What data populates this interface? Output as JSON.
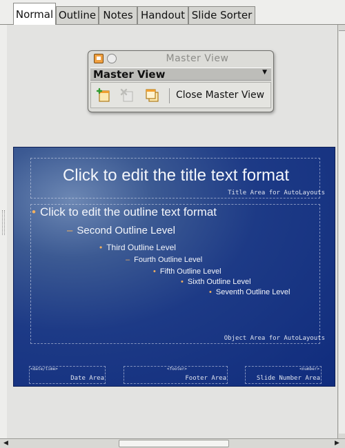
{
  "tabs": [
    {
      "label": "Normal",
      "active": true
    },
    {
      "label": "Outline",
      "active": false
    },
    {
      "label": "Notes",
      "active": false
    },
    {
      "label": "Handout",
      "active": false
    },
    {
      "label": "Slide Sorter",
      "active": false
    }
  ],
  "master_view": {
    "window_title": "Master View",
    "header_label": "Master View",
    "close_label": "Close Master View",
    "icons": [
      "window-menu-icon",
      "window-circle-icon",
      "new-master-icon",
      "delete-master-icon",
      "rename-master-icon",
      "dropdown-arrow-icon"
    ]
  },
  "slide": {
    "title_placeholder": "Click to edit the title text format",
    "title_area_label": "Title Area for AutoLayouts",
    "object_area_label": "Object Area for AutoLayouts",
    "outline": [
      {
        "bullet": "•",
        "text": "Click to edit the outline text format"
      },
      {
        "bullet": "–",
        "text": "Second Outline Level"
      },
      {
        "bullet": "•",
        "text": "Third Outline Level"
      },
      {
        "bullet": "–",
        "text": "Fourth Outline Level"
      },
      {
        "bullet": "•",
        "text": "Fifth Outline Level"
      },
      {
        "bullet": "•",
        "text": "Sixth Outline Level"
      },
      {
        "bullet": "•",
        "text": "Seventh Outline Level"
      }
    ],
    "footer": {
      "date_field": "<date/time>",
      "date_label": "Date Area",
      "footer_field": "<footer>",
      "footer_label": "Footer Area",
      "number_field": "<number>",
      "number_label": "Slide Number Area"
    }
  },
  "colors": {
    "slide_background": "#1d3a86",
    "bullet": "#f0b060",
    "tab_active": "#ffffff",
    "tab_inactive": "#d4d4d0"
  }
}
